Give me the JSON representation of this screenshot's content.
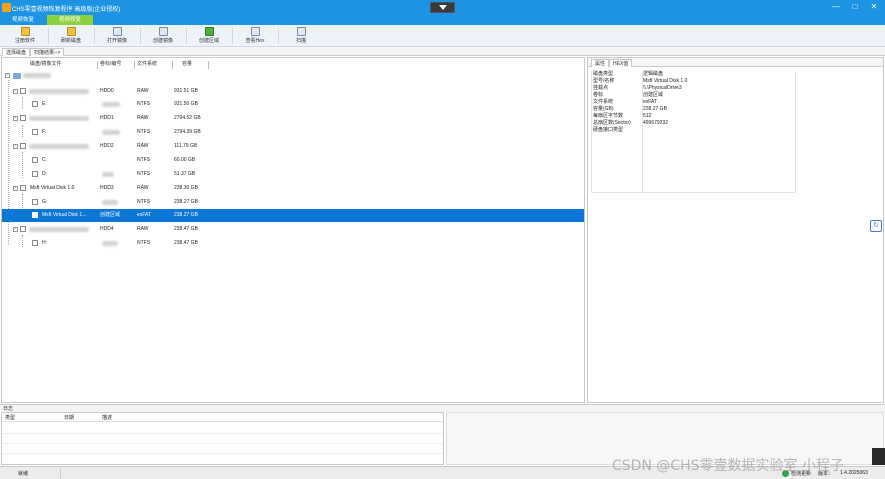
{
  "window": {
    "title": "CHS零壹视频恢复程序 高级版(企业授权)",
    "controls": [
      "—",
      "□",
      "✕"
    ]
  },
  "menu": {
    "tabs": [
      {
        "label": "视频恢复",
        "active": false
      },
      {
        "label": "视频修复",
        "active": true
      }
    ]
  },
  "toolbar": {
    "items": [
      {
        "label": "注册软件",
        "icon": "register-icon"
      },
      {
        "label": "刷新磁盘",
        "icon": "refresh-disk-icon"
      },
      {
        "label": "打开镜像",
        "icon": "open-image-icon"
      },
      {
        "label": "创建镜像",
        "icon": "create-image-icon"
      },
      {
        "label": "创建区域",
        "icon": "create-region-icon"
      },
      {
        "label": "查看Hex",
        "icon": "view-hex-icon"
      },
      {
        "label": "扫描",
        "icon": "scan-icon"
      }
    ]
  },
  "subtabs": [
    {
      "label": "选择磁盘",
      "active": true
    },
    {
      "label": "扫描结果-->",
      "active": false
    }
  ],
  "disk_table": {
    "columns": [
      "磁盘/镜像文件",
      "卷标/编号",
      "文件系统",
      "容量"
    ],
    "rows": [
      {
        "level": 1,
        "name": "",
        "id": "HDD0",
        "fs": "RAW",
        "size": "931.51 GB",
        "selected": false
      },
      {
        "level": 2,
        "name": "E:",
        "id": "",
        "fs": "NTFS",
        "size": "931.50 GB",
        "selected": false
      },
      {
        "level": 1,
        "name": "",
        "id": "HDD1",
        "fs": "RAW",
        "size": "2794.52 GB",
        "selected": false
      },
      {
        "level": 2,
        "name": "F:",
        "id": "",
        "fs": "NTFS",
        "size": "2794.39 GB",
        "selected": false
      },
      {
        "level": 1,
        "name": "",
        "id": "HDD2",
        "fs": "RAW",
        "size": "111.79 GB",
        "selected": false
      },
      {
        "level": 2,
        "name": "C:",
        "id": "",
        "fs": "NTFS",
        "size": "60.00 GB",
        "selected": false
      },
      {
        "level": 2,
        "name": "D:",
        "id": "",
        "fs": "NTFS",
        "size": "51.37 GB",
        "selected": false
      },
      {
        "level": 1,
        "name": "Msft    Virtual Disk     1.0",
        "id": "HDD3",
        "fs": "RAW",
        "size": "238.30 GB",
        "selected": false
      },
      {
        "level": 2,
        "name": "G:",
        "id": "",
        "fs": "NTFS",
        "size": "238.27 GB",
        "selected": false
      },
      {
        "level": 2,
        "name": "Msft    Virtual Disk    1...",
        "id": "创建区域",
        "fs": "exFAT",
        "size": "238.27 GB",
        "selected": true
      },
      {
        "level": 1,
        "name": "",
        "id": "HDD4",
        "fs": "RAW",
        "size": "238.47 GB",
        "selected": false
      },
      {
        "level": 2,
        "name": "H:",
        "id": "",
        "fs": "NTFS",
        "size": "238.47 GB",
        "selected": false
      }
    ]
  },
  "properties": {
    "tabs": [
      {
        "label": "属性",
        "active": true
      },
      {
        "label": "HEX值",
        "active": false
      }
    ],
    "items": [
      {
        "key": "磁盘类型",
        "value": "逻辑磁盘"
      },
      {
        "key": "型号/名称",
        "value": "Msft    Virtual Disk    1.0"
      },
      {
        "key": "挂载点",
        "value": "\\\\.\\PhysicalDrive3"
      },
      {
        "key": "卷标",
        "value": "创建区域"
      },
      {
        "key": "文件系统",
        "value": "exFAT"
      },
      {
        "key": "容量(GB)",
        "value": "238.27 GB"
      },
      {
        "key": "每扇区字节数",
        "value": "512"
      },
      {
        "key": "总扇区数(Sector)",
        "value": "499679232"
      },
      {
        "key": "硬盘接口类型",
        "value": ""
      }
    ]
  },
  "log": {
    "title": "日志",
    "columns": [
      "类型",
      "日期",
      "描述"
    ]
  },
  "statusbar": {
    "status": "就绪",
    "update_label": "检测更新",
    "version_label": "版本：",
    "version": "1.4.2025063"
  },
  "watermark": "CSDN @CHS零壹数据实验室 小程子",
  "colors": {
    "titlebar": "#1e93e3",
    "active_tab": "#8bd23c",
    "selection": "#0a76d6"
  }
}
